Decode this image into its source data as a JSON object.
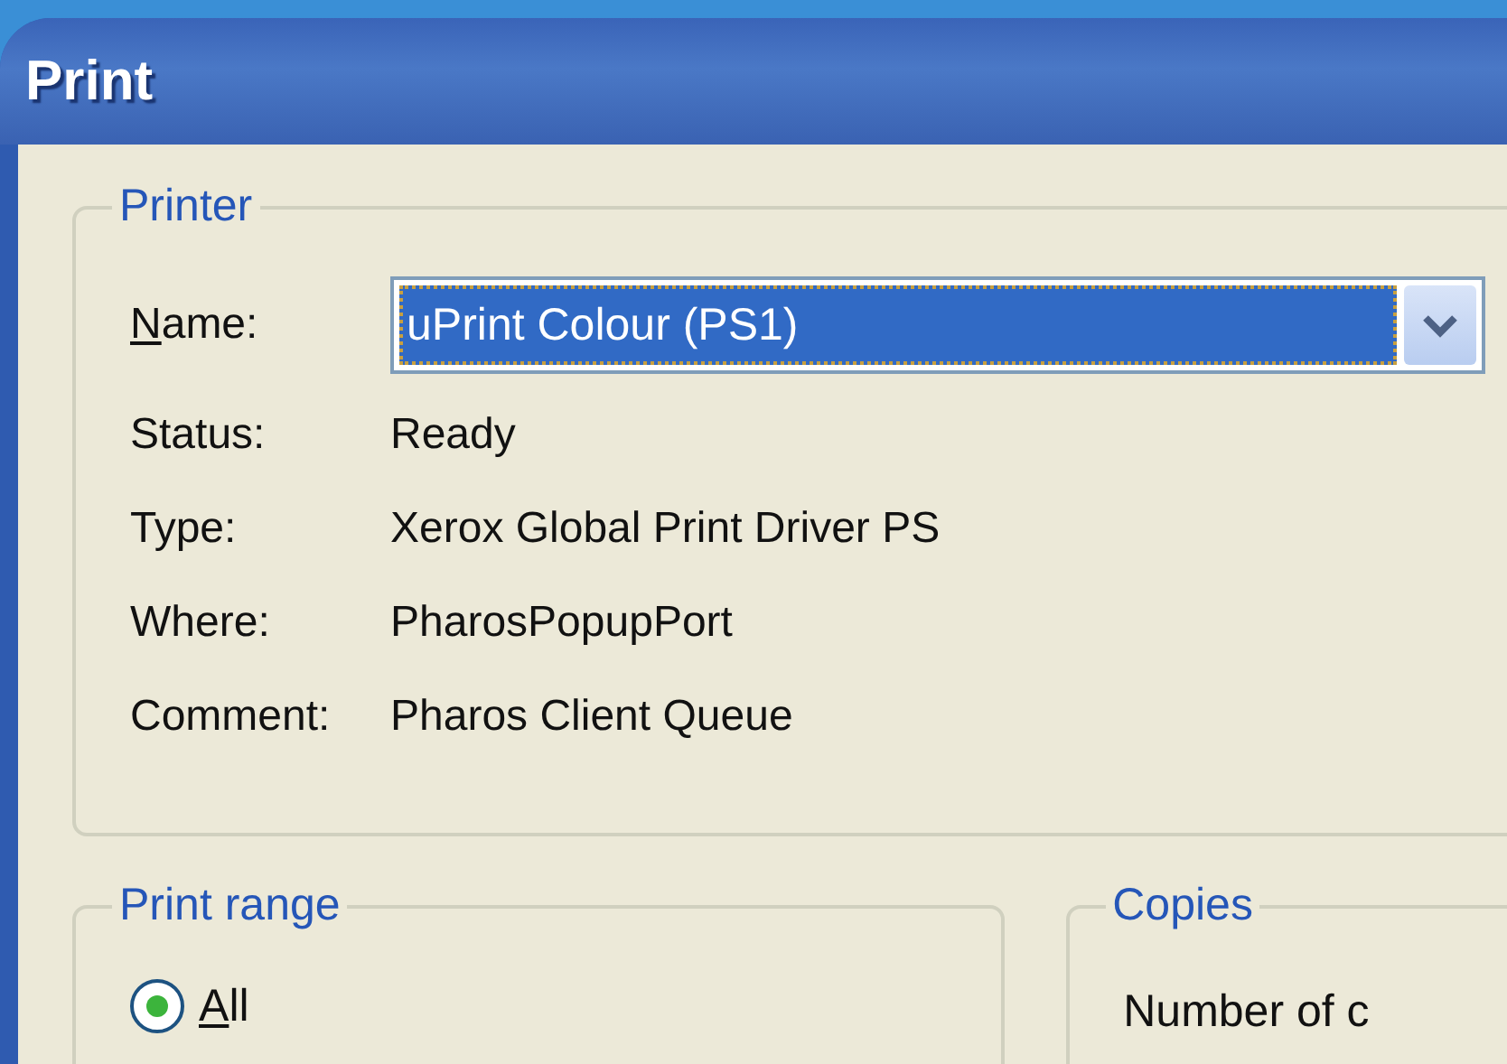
{
  "window": {
    "title": "Print"
  },
  "printer": {
    "legend": "Printer",
    "name_label": "Name:",
    "name_mnemonic": true,
    "name_value": "uPrint Colour (PS1)",
    "name_selected": true,
    "info": [
      {
        "label": "Status:",
        "value": "Ready"
      },
      {
        "label": "Type:",
        "value": "Xerox Global Print Driver PS"
      },
      {
        "label": "Where:",
        "value": "PharosPopupPort"
      },
      {
        "label": "Comment:",
        "value": "Pharos Client Queue"
      }
    ]
  },
  "print_range": {
    "legend": "Print range",
    "options": [
      {
        "label": "All",
        "mnemonic": true,
        "selected": true
      }
    ]
  },
  "copies": {
    "legend": "Copies",
    "number_label": "Number of c"
  }
}
